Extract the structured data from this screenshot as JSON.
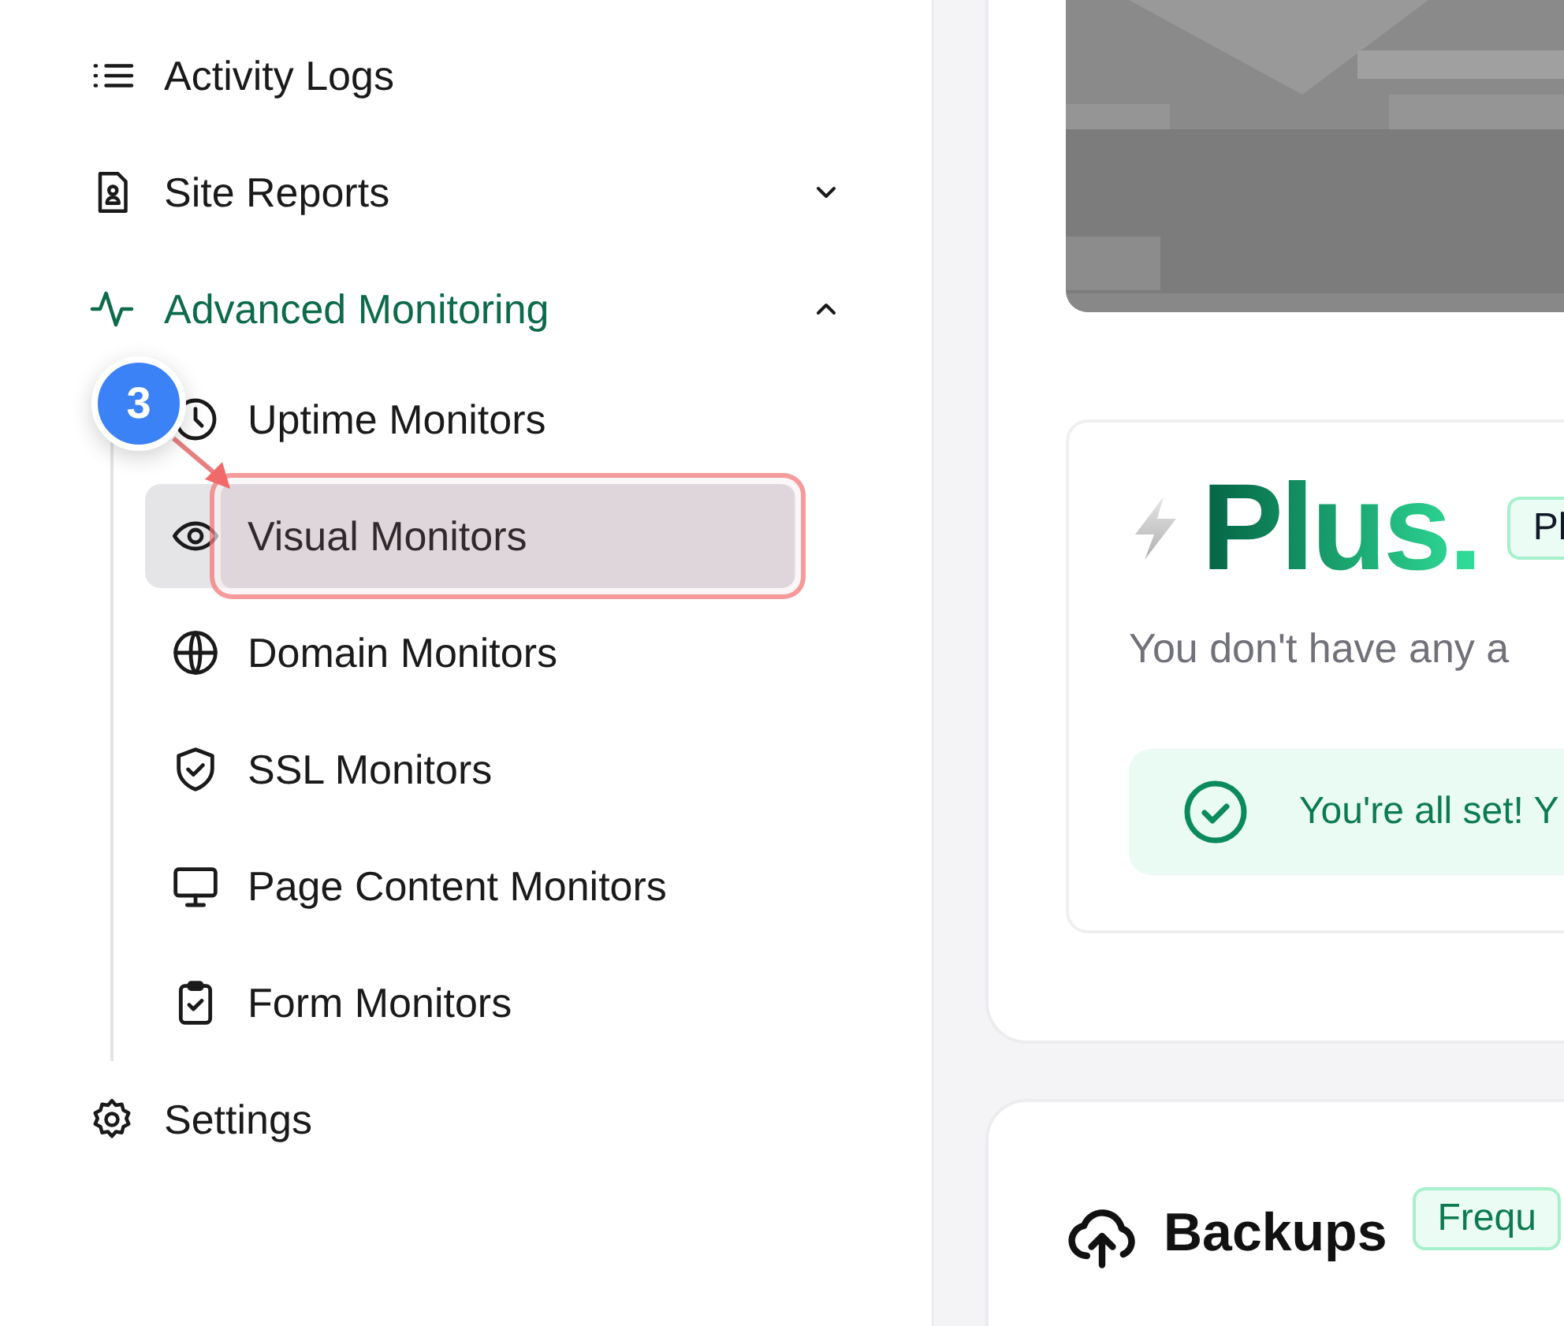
{
  "sidebar": {
    "items": [
      {
        "label": "Activity Logs"
      },
      {
        "label": "Site Reports",
        "expanded": false
      },
      {
        "label": "Advanced Monitoring",
        "expanded": true,
        "children": [
          {
            "label": "Uptime Monitors",
            "selected": false
          },
          {
            "label": "Visual Monitors",
            "selected": true
          },
          {
            "label": "Domain Monitors",
            "selected": false
          },
          {
            "label": "SSL Monitors",
            "selected": false
          },
          {
            "label": "Page Content Monitors",
            "selected": false
          },
          {
            "label": "Form Monitors",
            "selected": false
          }
        ]
      },
      {
        "label": "Settings"
      }
    ]
  },
  "annotation": {
    "badge": "3"
  },
  "plus_card": {
    "title": "Plus.",
    "badge": "Pl",
    "text": "You don't have any a",
    "notice": "You're all set! Y"
  },
  "backups_card": {
    "title": "Backups",
    "badge": "Frequ"
  }
}
